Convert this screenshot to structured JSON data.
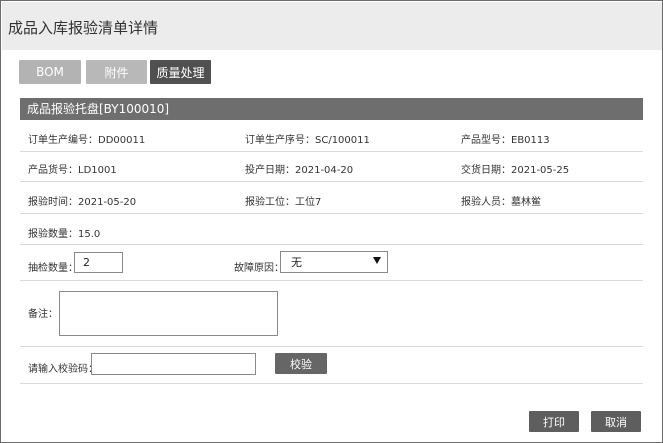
{
  "page": {
    "title": "成品入库报验清单详情"
  },
  "tabs": {
    "bom": "BOM",
    "attachment": "附件",
    "quality": "质量处理"
  },
  "section": {
    "header": "成品报验托盘[BY100010]"
  },
  "info": {
    "order_no": "订单生产编号：DD00011",
    "order_seq": "订单生产序号：SC/100011",
    "product_model": "产品型号：EB0113",
    "product_code": "产品货号：LD1001",
    "production_date": "投产日期：2021-04-20",
    "delivery_date": "交货日期：2021-05-25",
    "inspect_time": "报验时间：2021-05-20",
    "inspect_station": "报验工位：工位7",
    "inspector": "报验人员：墓林鲎",
    "inspect_qty": "报验数量：15.0"
  },
  "form": {
    "sample_qty_label": "抽检数量：",
    "sample_qty_value": "2",
    "fault_reason_label": "故障原因：",
    "fault_reason_value": "无",
    "remark_label": "备注：",
    "check_code_label": "请输入校验码：",
    "check_code_value": "",
    "verify_button": "校验"
  },
  "footer": {
    "print_button": "打印",
    "cancel_button": "取消"
  }
}
